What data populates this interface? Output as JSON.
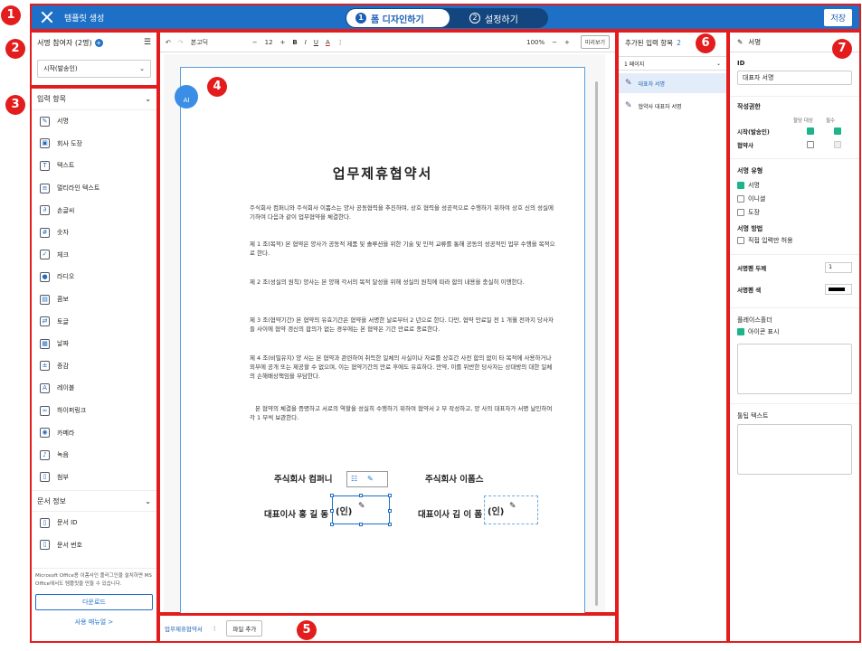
{
  "header": {
    "title": "템플릿 생성",
    "step1": "폼 디자인하기",
    "step1_num": "1",
    "step2": "설정하기",
    "step2_num": "2",
    "save": "저장"
  },
  "participants": {
    "title": "서명 참여자 (2명)",
    "selected": "시작(발송인)"
  },
  "input_items": {
    "title": "입력 항목",
    "items": [
      {
        "label": "서명",
        "icon": "pen-icon"
      },
      {
        "label": "회사 도장",
        "icon": "stamp-icon"
      },
      {
        "label": "텍스트",
        "icon": "text-icon"
      },
      {
        "label": "멀티라인 텍스트",
        "icon": "multiline-icon"
      },
      {
        "label": "손글씨",
        "icon": "handwriting-icon"
      },
      {
        "label": "숫자",
        "icon": "number-icon"
      },
      {
        "label": "체크",
        "icon": "check-icon"
      },
      {
        "label": "라디오",
        "icon": "radio-icon"
      },
      {
        "label": "콤보",
        "icon": "combo-icon"
      },
      {
        "label": "토글",
        "icon": "toggle-icon"
      },
      {
        "label": "날짜",
        "icon": "calendar-icon"
      },
      {
        "label": "증감",
        "icon": "stepper-icon"
      },
      {
        "label": "레이블",
        "icon": "label-icon"
      },
      {
        "label": "하이퍼링크",
        "icon": "link-icon"
      },
      {
        "label": "카메라",
        "icon": "camera-icon"
      },
      {
        "label": "녹음",
        "icon": "mic-icon"
      },
      {
        "label": "첨부",
        "icon": "attach-icon"
      }
    ],
    "doc_info_title": "문서 정보",
    "doc_items": [
      {
        "label": "문서 ID"
      },
      {
        "label": "문서 번호"
      }
    ],
    "note": "Microsoft Office용 이폼사인 플러그인을 설치하면 MS Office에서도 템플릿을 만들 수 있습니다.",
    "download": "다운로드",
    "manual": "사용 매뉴얼 >"
  },
  "toolbar": {
    "font": "본고딕",
    "size": "12",
    "zoom": "100%",
    "preview": "미리보기"
  },
  "document": {
    "ai": "AI",
    "title": "업무제휴협약서",
    "paragraphs": [
      "주식회사 컴퍼니와 주식회사 이폼스는 양사 공동협력을 추진하며, 상호 협력을 성공적으로 수행하기 위하여 상호 신의 성실에 기하여 다음과 같이 업무협약을 체결한다.",
      "제 1 조(목적) 본 협약은 양사가 공동적 제품 및 솔루션을 위한 기술 및 인적 교류를 통해 공동의 성공적인 업무 수행을 목적으로 한다.",
      "제 2 조(성실의 원칙) 양사는 본 양해 각서의 목적 달성을 위해 성실의 원칙에 따라 합의 내용을 충실히 이행한다.",
      "제 3 조(협약기간) 본 협약의 유효기간은 협약을 서명한 날로부터 2 년으로 한다. 다만, 협약 만료일 전 1 개월 전까지 당사자들 사이에 협약 갱신의 합의가 없는 경우에는 본 협약은 기간 만료로 종료한다.",
      "제 4 조(비밀유지) 양 사는 본 협약과 관련하여 취득한 일체의 사실이나 자료를 상호간 사전 합의 없이 타 목적에 사용하거나 외부에 공개 또는 제공할 수 없으며, 이는 협약기간의 만료 후에도 유효하다. 만약, 이를 위반한 당사자는 상대방의 대한 일체의 손해배상책임을 부담한다.",
      "본 협약의 체결을 증명하고 서로의 역할을 성실히 수행하기 위하여 협약서 2 부 작성하고, 양 사의 대표자가 서명 날인하여 각 1 부씩 보관한다."
    ],
    "company1": "주식회사 컴퍼니",
    "company2": "주식회사 이폼스",
    "rep1": "대표이사 홍 길 동",
    "rep2": "대표이사 김 이 폼",
    "seal": "(인)"
  },
  "bottom": {
    "tab": "업무제휴협약서",
    "add": "파일 추가"
  },
  "added_items": {
    "title": "추가된 입력 항목",
    "count": "2",
    "page": "1 페이지",
    "rows": [
      "대표자 서명",
      "협약사 대표자 서명"
    ]
  },
  "props": {
    "title": "서명",
    "id_label": "ID",
    "id_value": "대표자 서명",
    "perm_label": "작성권한",
    "col_assign": "할당 대상",
    "col_required": "필수",
    "perm_rows": [
      "시작(발송인)",
      "협약사"
    ],
    "type_label": "서명 유형",
    "types": [
      "서명",
      "이니셜",
      "도장"
    ],
    "method_label": "서명 방법",
    "method_opt": "직접 입력만 허용",
    "pen_width_label": "서명펜 두께",
    "pen_width": "1",
    "pen_color_label": "서명펜 색",
    "placeholder_label": "플레이스홀더",
    "show_icon": "아이콘 표시",
    "tooltip_label": "툴팁 텍스트"
  },
  "markers": [
    "1",
    "2",
    "3",
    "4",
    "5",
    "6",
    "7"
  ]
}
